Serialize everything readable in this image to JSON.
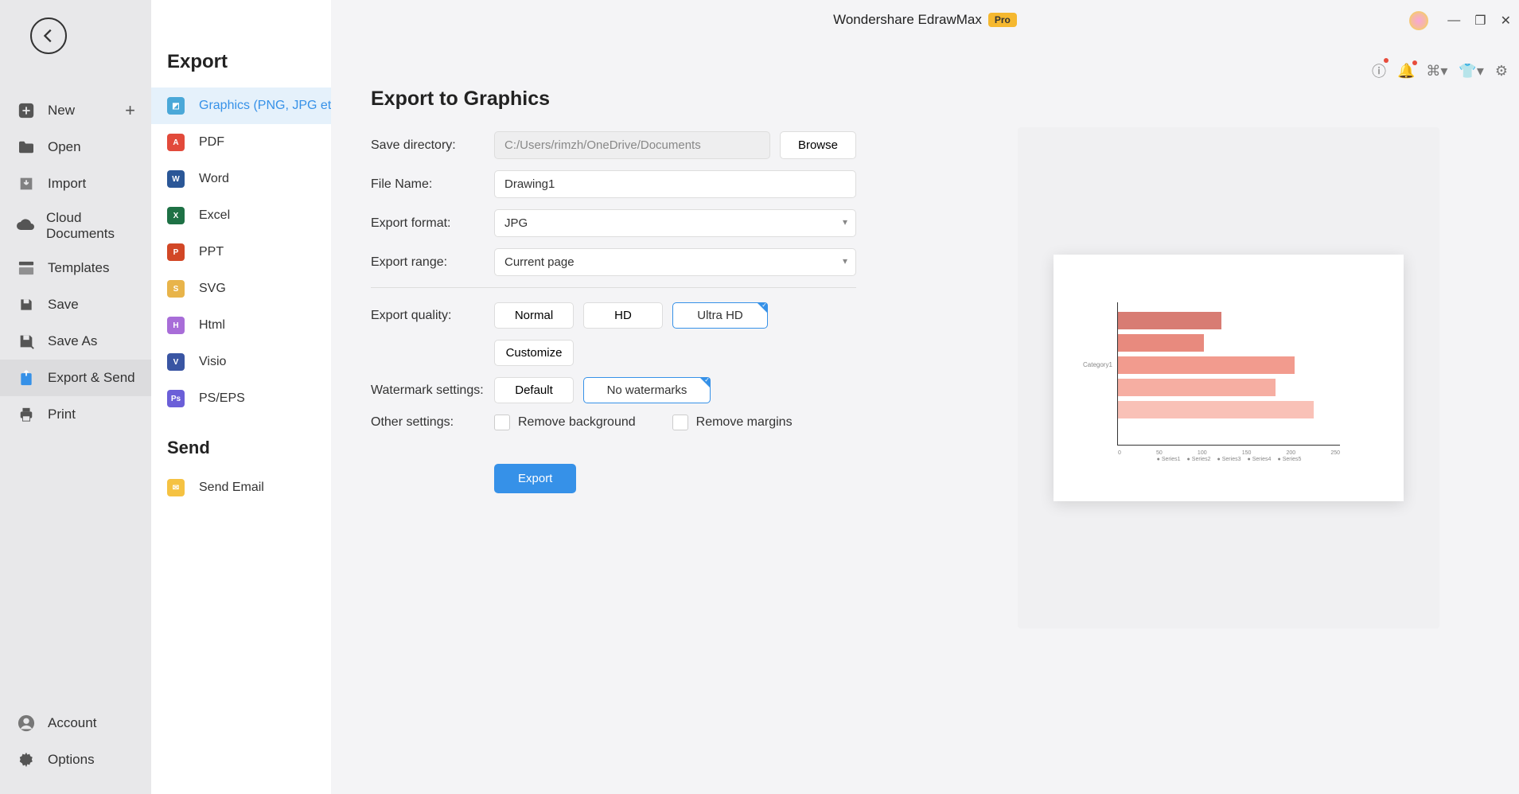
{
  "app": {
    "title": "Wondershare EdrawMax",
    "badge": "Pro"
  },
  "nav": {
    "new": "New",
    "open": "Open",
    "import": "Import",
    "cloud": "Cloud Documents",
    "templates": "Templates",
    "save": "Save",
    "saveas": "Save As",
    "export_send": "Export & Send",
    "print": "Print",
    "account": "Account",
    "options": "Options"
  },
  "export_panel": {
    "heading_export": "Export",
    "heading_send": "Send",
    "items": {
      "graphics": "Graphics (PNG, JPG et...",
      "pdf": "PDF",
      "word": "Word",
      "excel": "Excel",
      "ppt": "PPT",
      "svg": "SVG",
      "html": "Html",
      "visio": "Visio",
      "pseps": "PS/EPS",
      "send_email": "Send Email"
    }
  },
  "form": {
    "title": "Export to Graphics",
    "labels": {
      "save_dir": "Save directory:",
      "file_name": "File Name:",
      "format": "Export format:",
      "range": "Export range:",
      "quality": "Export quality:",
      "watermark": "Watermark settings:",
      "other": "Other settings:"
    },
    "save_dir": "C:/Users/rimzh/OneDrive/Documents",
    "browse": "Browse",
    "file_name": "Drawing1",
    "format": "JPG",
    "range": "Current page",
    "quality": {
      "normal": "Normal",
      "hd": "HD",
      "uhd": "Ultra HD",
      "customize": "Customize"
    },
    "watermark": {
      "default": "Default",
      "none": "No watermarks"
    },
    "checks": {
      "remove_bg": "Remove background",
      "remove_margins": "Remove margins"
    },
    "export_btn": "Export"
  },
  "chart_data": {
    "type": "bar",
    "orientation": "horizontal",
    "categories": [
      "Series1",
      "Series2",
      "Series3",
      "Series4",
      "Series5"
    ],
    "values": [
      130,
      108,
      222,
      198,
      246
    ],
    "title": "",
    "xlabel": "",
    "ylabel": "Category1",
    "colors": [
      "#d87c73",
      "#e88a7e",
      "#f29b8e",
      "#f6aea2",
      "#f9c1b7"
    ]
  }
}
